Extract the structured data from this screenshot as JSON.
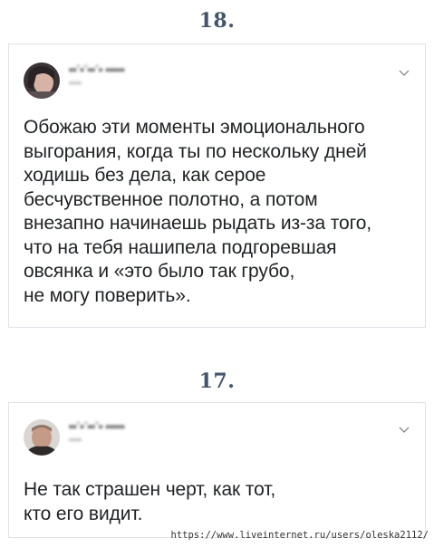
{
  "posts": [
    {
      "number": "18.",
      "author_name": "••´•´••´• •••••",
      "author_handle": "••••",
      "text_lines": [
        "Обожаю эти моменты эмоционального",
        "выгорания, когда ты по нескольку дней",
        "ходишь без дела, как серое",
        "бесчувственное полотно, а потом",
        "внезапно начинаешь рыдать из-за того,",
        "что на тебя нашипела подгоревшая",
        "овсянка и «это было так грубо,",
        "не могу поверить»."
      ],
      "menu_icon": "chevron-down-icon"
    },
    {
      "number": "17.",
      "author_name": "••´•´••´• •••••",
      "author_handle": "••••",
      "text_lines": [
        "Не так страшен черт, как тот,",
        "кто его видит."
      ],
      "menu_icon": "chevron-down-icon"
    }
  ],
  "watermark": "https://www.liveinternet.ru/users/oleska2112/"
}
